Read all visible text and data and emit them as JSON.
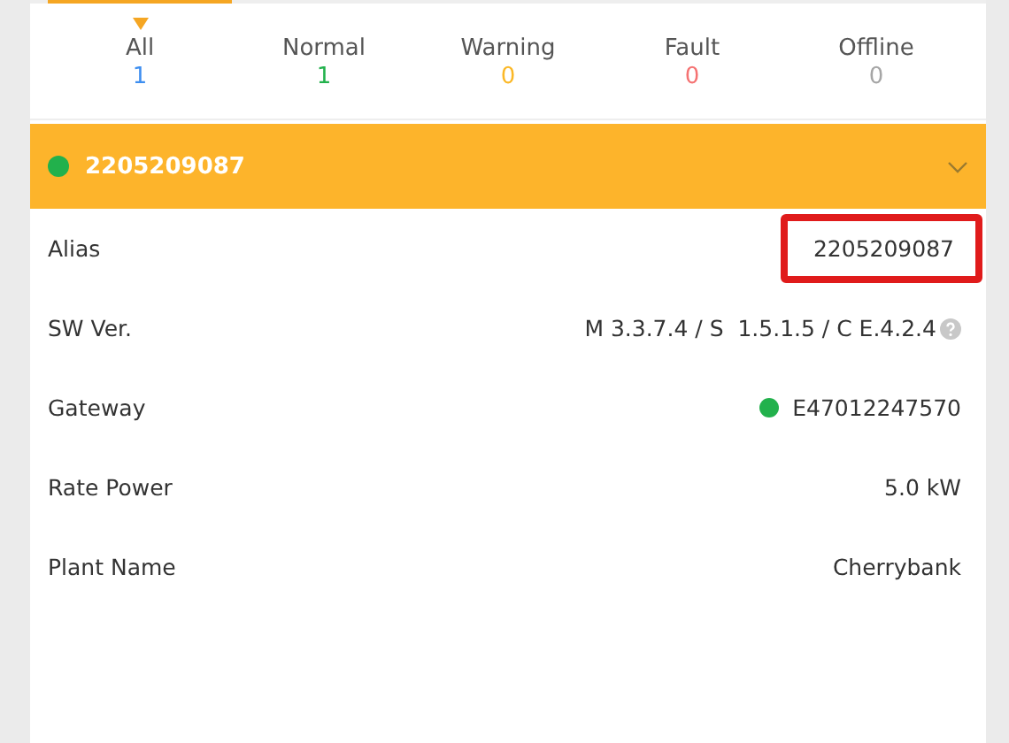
{
  "tabs": [
    {
      "label": "All",
      "count": "1",
      "color": "#3d8ef0",
      "selected": true
    },
    {
      "label": "Normal",
      "count": "1",
      "color": "#22b14c",
      "selected": false
    },
    {
      "label": "Warning",
      "count": "0",
      "color": "#fbb827",
      "selected": false
    },
    {
      "label": "Fault",
      "count": "0",
      "color": "#f57373",
      "selected": false
    },
    {
      "label": "Offline",
      "count": "0",
      "color": "#a6a6a6",
      "selected": false
    }
  ],
  "device": {
    "serial": "2205209087",
    "color": "#22b14c",
    "expanded": true
  },
  "rows": [
    {
      "label": "Alias",
      "value": "2205209087",
      "kind": "text",
      "highlighted": true
    },
    {
      "label": "SW Ver.",
      "value": "M 3.3.7.4 / S  1.5.1.5 / C E.4.2.4",
      "kind": "help",
      "highlighted": false
    },
    {
      "label": "Gateway",
      "value": "E47012247570",
      "kind": "status",
      "color": "#22b14c",
      "highlighted": false
    },
    {
      "label": "Rate Power",
      "value": "5.0 kW",
      "kind": "text",
      "highlighted": false
    },
    {
      "label": "Plant Name",
      "value": "Cherrybank",
      "kind": "text",
      "highlighted": false
    }
  ]
}
